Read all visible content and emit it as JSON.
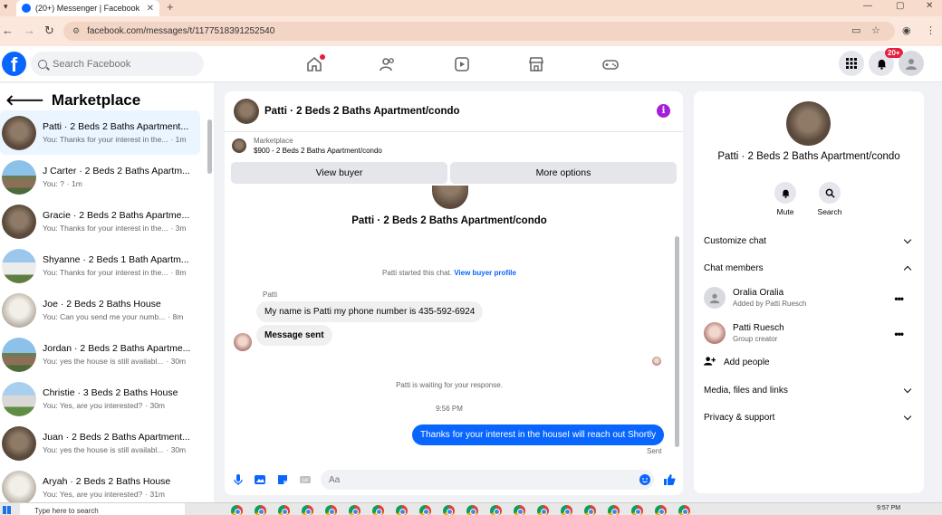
{
  "browser": {
    "tab_title": "(20+) Messenger | Facebook",
    "url": "facebook.com/messages/t/1177518391252540"
  },
  "header": {
    "logo": "f",
    "search_placeholder": "Search Facebook",
    "notification_badge": "20+",
    "nav_icons": [
      "home-icon",
      "friends-icon",
      "watch-icon",
      "marketplace-icon",
      "gaming-icon"
    ]
  },
  "left": {
    "title": "Marketplace",
    "chats": [
      {
        "name": "Patti · 2 Beds 2 Baths Apartment...",
        "preview": "You: Thanks for your interest in the...",
        "time": "· 1m",
        "thumb": "t1",
        "active": true
      },
      {
        "name": "J Carter · 2 Beds 2 Baths Apartm...",
        "preview": "You: ?",
        "time": "· 1m",
        "thumb": "t2",
        "active": false
      },
      {
        "name": "Gracie · 2 Beds 2 Baths Apartme...",
        "preview": "You: Thanks for your interest in the...",
        "time": "· 3m",
        "thumb": "t1",
        "active": false
      },
      {
        "name": "Shyanne · 2 Beds 1 Bath Apartm...",
        "preview": "You: Thanks for your interest in the...",
        "time": "· 8m",
        "thumb": "t3",
        "active": false
      },
      {
        "name": "Joe · 2 Beds 2 Baths House",
        "preview": "You: Can you send me your numb...",
        "time": "· 8m",
        "thumb": "t4",
        "active": false
      },
      {
        "name": "Jordan · 2 Beds 2 Baths Apartme...",
        "preview": "You: yes the house is still availabl...",
        "time": "· 30m",
        "thumb": "t2",
        "active": false
      },
      {
        "name": "Christie · 3 Beds 2 Baths House",
        "preview": "You: Yes, are you interested?",
        "time": "· 30m",
        "thumb": "t5",
        "active": false
      },
      {
        "name": "Juan · 2 Beds 2 Baths Apartment...",
        "preview": "You: yes the house is still availabl...",
        "time": "· 30m",
        "thumb": "t1",
        "active": false
      },
      {
        "name": "Aryah · 2 Beds 2 Baths House",
        "preview": "You: Yes, are you interested?",
        "time": "· 31m",
        "thumb": "t4",
        "active": false
      }
    ]
  },
  "convo": {
    "title": "Patti · 2 Beds 2 Baths Apartment/condo",
    "marketplace_label": "Marketplace",
    "listing": "$900 - 2 Beds 2 Baths Apartment/condo",
    "view_buyer": "View buyer",
    "more_options": "More options",
    "started_text": "Patti started this chat.",
    "view_profile": "View buyer profile",
    "sender": "Patti",
    "msg1": "My name is Patti my phone number is 435-592-6924",
    "msg2": "Message sent",
    "waiting": "Patti is waiting for your response.",
    "timestamp": "9:56 PM",
    "reply": "Thanks for your interest in the houseI will reach out Shortly",
    "sent": "Sent",
    "compose_placeholder": "Aa"
  },
  "info": {
    "title": "Patti · 2 Beds 2 Baths Apartment/condo",
    "mute": "Mute",
    "search": "Search",
    "customize": "Customize chat",
    "members": "Chat members",
    "member1_name": "Oralia Oralia",
    "member1_role": "Added by Patti Ruesch",
    "member2_name": "Patti Ruesch",
    "member2_role": "Group creator",
    "add_people": "Add people",
    "media": "Media, files and links",
    "privacy": "Privacy & support"
  },
  "taskbar": {
    "search_placeholder": "Type here to search",
    "time": "9:57 PM"
  },
  "colors": {
    "brand": "#0866ff",
    "info_icon": "#a61edb",
    "badge": "#e41e3f"
  }
}
